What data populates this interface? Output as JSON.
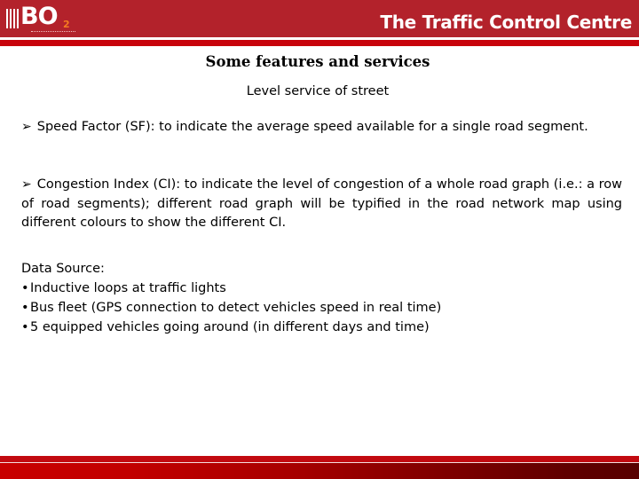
{
  "header": {
    "logo_text": "BO",
    "logo_subscript": "2",
    "title": "The Traffic Control Centre",
    "colors": {
      "header_red": "#b3222b",
      "bar_red": "#c8030b",
      "logo_accent": "#f47b20"
    }
  },
  "content": {
    "heading": "Some features and services",
    "subheading": "Level service of street",
    "bullet_glyph": "➢",
    "paragraphs": [
      {
        "term": "Speed Factor (SF)",
        "text": "Speed Factor (SF): to indicate the average speed available for a single road segment."
      },
      {
        "term": "Congestion Index (CI)",
        "text": "Congestion Index (CI): to indicate the level of congestion of a whole road graph (i.e.: a row of road segments); different road graph will be typified in the road network map using different colours to show the different CI."
      }
    ],
    "data_source": {
      "label": "Data Source:",
      "dot_glyph": "•",
      "items": [
        "Inductive loops at traffic lights",
        "Bus fleet (GPS connection to detect vehicles speed in real time)",
        "5 equipped vehicles going around (in different days and time)"
      ]
    }
  },
  "footer": {
    "colors": {
      "band_red": "#c20a10",
      "gradient_start": "#c80000",
      "gradient_end": "#580000"
    }
  }
}
